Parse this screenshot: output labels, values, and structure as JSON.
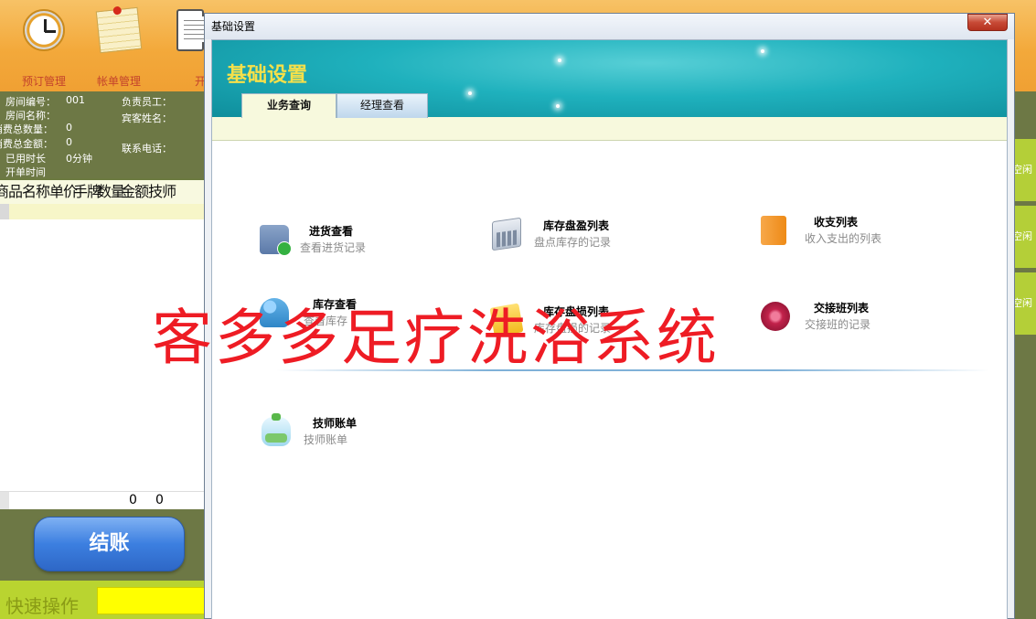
{
  "toolbar": {
    "items": [
      {
        "label": "预订管理",
        "icon": "clock-icon"
      },
      {
        "label": "帐单管理",
        "icon": "note-icon"
      },
      {
        "label": "开单",
        "icon": "document-icon"
      }
    ]
  },
  "room_info": {
    "room_no_label": "房间编号：",
    "room_no_value": "001",
    "room_name_label": "房间名称：",
    "consume_qty_label": "消费总数量：",
    "consume_qty_value": "0",
    "consume_amount_label": "消费总金额：",
    "consume_amount_value": "0",
    "used_time_label": "已用时长",
    "used_time_value": "0分钟",
    "open_time_label": "开单时间",
    "staff_label": "负责员工：",
    "guest_label": "宾客姓名：",
    "phone_label": "联系电话："
  },
  "bill_table": {
    "headers": [
      "商品名称",
      "单价",
      "手牌",
      "数量",
      "金额",
      "技师"
    ],
    "total_qty": "0",
    "total_amount": "0"
  },
  "checkout_label": "结账",
  "quick_op_label": "快速操作",
  "room_tiles": [
    "空闲",
    "空闲",
    "空闲"
  ],
  "dialog": {
    "title": "基础设置",
    "close_glyph": "✕",
    "banner_title": "基础设置",
    "tabs": [
      {
        "label": "业务查询",
        "active": true
      },
      {
        "label": "经理查看",
        "active": false
      }
    ],
    "items": [
      {
        "title": "进货查看",
        "subtitle": "查看进货记录",
        "icon": "folder-icon"
      },
      {
        "title": "库存盘盈列表",
        "subtitle": "盘点库存的记录",
        "icon": "calculator-icon"
      },
      {
        "title": "收支列表",
        "subtitle": "收入支出的列表",
        "icon": "orange-book-icon"
      },
      {
        "title": "库存查看",
        "subtitle": "查看库存",
        "icon": "people-icon"
      },
      {
        "title": "库存盘损列表",
        "subtitle": "库存盘损的记录",
        "icon": "yellow-folder-icon"
      },
      {
        "title": "交接班列表",
        "subtitle": "交接班的记录",
        "icon": "red-ball-icon"
      },
      {
        "title": "技师账单",
        "subtitle": "技师账单",
        "icon": "bottle-icon"
      }
    ]
  },
  "watermark": "客多多足疗洗浴系统",
  "colors": {
    "toolbar": "#f3a93b",
    "panel": "#6d7845",
    "banner": "#1fb1bd",
    "banner_title": "#f5e04a",
    "checkout": "#3c7fe0",
    "quick_input": "#ffff00",
    "watermark": "#ee1c24"
  }
}
